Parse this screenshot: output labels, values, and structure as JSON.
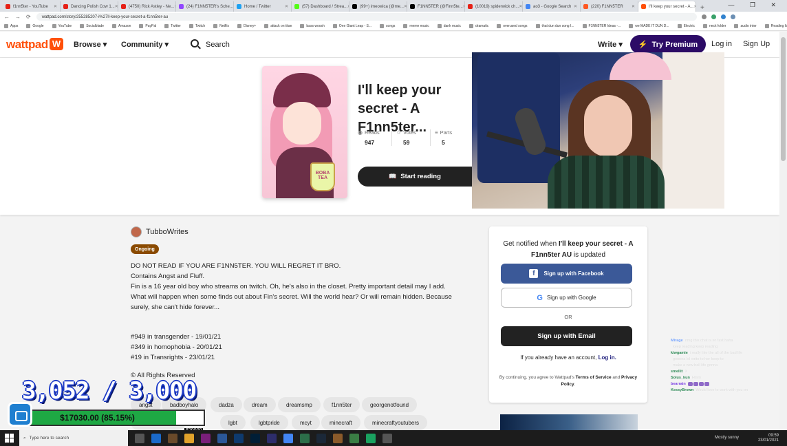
{
  "browser": {
    "tabs": [
      {
        "label": "f1nn5ter - YouTube",
        "color": "#e62117"
      },
      {
        "label": "Dancing Polish Cow 1...",
        "color": "#e62117"
      },
      {
        "label": "(4750) Rick Astley - Ne...",
        "color": "#e62117"
      },
      {
        "label": "(24) F1NN5TER's Sche...",
        "color": "#9146ff"
      },
      {
        "label": "Home / Twitter",
        "color": "#1da1f2"
      },
      {
        "label": "(57) Dashboard / Strea...",
        "color": "#53fc18"
      },
      {
        "label": "(99+) imeowica (@me...",
        "color": "#000000"
      },
      {
        "label": "F1NN5TER (@Finn5te...",
        "color": "#000000"
      },
      {
        "label": "(10019) spiderwick ch...",
        "color": "#e62117"
      },
      {
        "label": "ao3 - Google Search",
        "color": "#4285f4"
      },
      {
        "label": "(220) F1NN5TER",
        "color": "#ff5722"
      },
      {
        "label": "I'll keep your secret - A...",
        "color": "#ff500a",
        "active": true
      }
    ],
    "url": "wattpad.com/story/255285207-i%27ll-keep-your-secret-a-f1nn5ter-au",
    "bookmarks": [
      "Apps",
      "Google",
      "YouTube",
      "Socialblade",
      "Amazon",
      "PayPal",
      "Twitter",
      "Twitch",
      "Netflix",
      "Disney+",
      "attack on titan",
      "bass woosh",
      "One Giant Leap - S...",
      "songs",
      "meme music",
      "dank music",
      "dramatic",
      "overused songs",
      "that dun dun song I...",
      "F1NN5TER Ideas -...",
      "we MADE IT DUN D...",
      "Electric",
      "neck folder",
      "audio inter",
      "Reading list"
    ]
  },
  "header": {
    "logo": "wattpad",
    "browse": "Browse ▾",
    "community": "Community ▾",
    "search": "Search",
    "write": "Write ▾",
    "premium": "Try Premium",
    "login": "Log in",
    "signup": "Sign Up"
  },
  "story": {
    "title": "I'll keep your secret - A F1nn5ter...",
    "cover_text": "BOBA TEA",
    "stats": [
      {
        "label": "Reads",
        "value": "947",
        "icon": "eye-icon"
      },
      {
        "label": "Votes",
        "value": "59",
        "icon": "star-icon"
      },
      {
        "label": "Parts",
        "value": "5",
        "icon": "list-icon"
      }
    ],
    "start_reading": "Start reading",
    "author": "TubboWrites",
    "status": "Ongoing",
    "description": [
      "DO NOT READ IF YOU ARE F1NN5TER. YOU WILL REGRET IT BRO.",
      "Contains Angst and Fluff.",
      "Fin is a 16 year old boy who streams on twitch. Oh, he's also in the closet. Pretty important detail may I add. What will happen when some finds out about Fin's secret. Will the world hear? Or will remain hidden. Because surely, she can't hide forever..."
    ],
    "ranks": [
      "#949 in transgender - 19/01/21",
      "#349 in homophobia - 20/01/21",
      "#19 in Transrights - 23/01/21"
    ],
    "rights": "© All Rights Reserved",
    "tags": [
      "angst",
      "badboyhalo",
      "dadza",
      "dream",
      "dreamsmp",
      "f1nn5ter",
      "georgenotfound",
      "georgenotfound",
      "lgbt",
      "lgbtpride",
      "mcyt",
      "minecraft",
      "minecraftyoutubers"
    ]
  },
  "signup_panel": {
    "head_prefix": "Get notified when ",
    "head_bold": "I'll keep your secret - A F1nn5ter AU",
    "head_suffix": " is updated",
    "facebook": "Sign up with Facebook",
    "google": "Sign up with Google",
    "or": "OR",
    "email": "Sign up with Email",
    "have_account": "If you already have an account, ",
    "login": "Log in.",
    "terms_prefix": "By continuing, you agree to Wattpad's ",
    "terms": "Terms of Service",
    "and": " and ",
    "privacy": "Privacy Policy",
    "period": "."
  },
  "stream": {
    "counter": "3,052 / 3,000",
    "donation_text": "$17030.00 (85.15%)",
    "donation_progress": 0.8515,
    "bar_aux": "$20000",
    "chat": [
      {
        "name": "Mirage",
        "msg": "omg this chat is so fast haha",
        "color": "#7aa7ff"
      },
      {
        "name": "",
        "msg": "keep reading keep reading",
        "color": "#d0d0d0"
      },
      {
        "name": "kiwgamie",
        "msg": "i really like the all of the bad life",
        "color": "#2e8b57"
      },
      {
        "name": "",
        "msg": "gonnna lol write to her keep to",
        "color": "#d0d0d0"
      },
      {
        "name": "",
        "msg": "make a new ball life gonna",
        "color": "#d0d0d0"
      },
      {
        "name": "smellit",
        "msg": "X",
        "color": "#2e8b57"
      },
      {
        "name": "Solus_kun",
        "msg": "Hmm",
        "color": "#2e8b57"
      },
      {
        "name": "bearrain",
        "msg": "",
        "color": "#7b3fe4"
      },
      {
        "name": "KessyBrown",
        "msg": "Would love to work with you on",
        "color": "#2e8b57"
      }
    ]
  },
  "taskbar": {
    "search": "Type here to search",
    "weather": "Mostly sunny",
    "time": "09:59",
    "date": "23/01/2021"
  }
}
